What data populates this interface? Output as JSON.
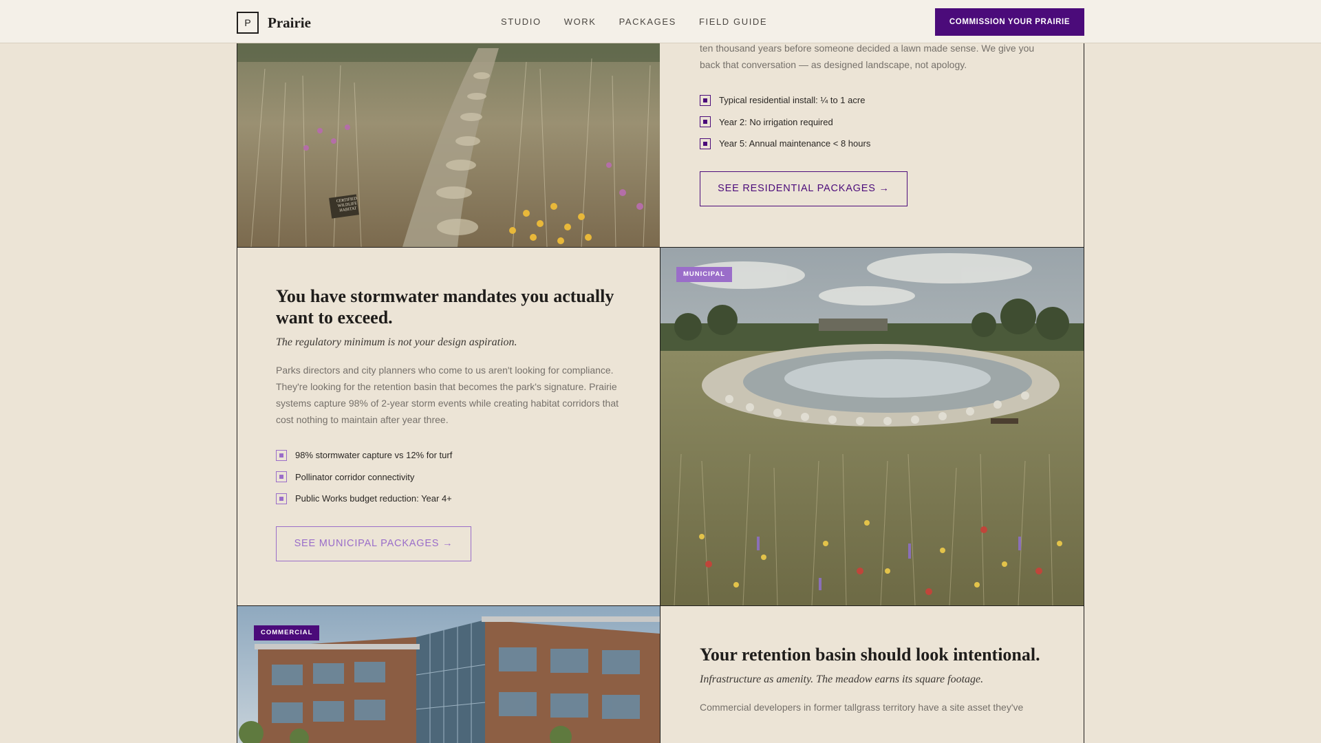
{
  "nav": {
    "logo_mark": "P",
    "brand": "Prairie",
    "links": [
      "STUDIO",
      "WORK",
      "PACKAGES",
      "FIELD GUIDE"
    ],
    "cta": "COMMISSION YOUR PRAIRIE"
  },
  "residential": {
    "body_tail": "ten thousand years before someone decided a lawn made sense. We give you back that conversation — as designed landscape, not apology.",
    "bullets": [
      "Typical residential install: ¼ to 1 acre",
      "Year 2: No irrigation required",
      "Year 5: Annual maintenance < 8 hours"
    ],
    "button": "SEE RESIDENTIAL PACKAGES →"
  },
  "municipal": {
    "tag": "MUNICIPAL",
    "heading": "You have stormwater mandates you actually want to exceed.",
    "subheading": "The regulatory minimum is not your design aspiration.",
    "body": "Parks directors and city planners who come to us aren't looking for compliance. They're looking for the retention basin that becomes the park's signature. Prairie systems capture 98% of 2-year storm events while creating habitat corridors that cost nothing to maintain after year three.",
    "bullets": [
      "98% stormwater capture vs 12% for turf",
      "Pollinator corridor connectivity",
      "Public Works budget reduction: Year 4+"
    ],
    "button": "SEE MUNICIPAL PACKAGES →"
  },
  "commercial": {
    "tag": "COMMERCIAL",
    "heading": "Your retention basin should look intentional.",
    "subheading": "Infrastructure as amenity. The meadow earns its square footage.",
    "body_start": "Commercial developers in former tallgrass territory have a site asset they've"
  },
  "colors": {
    "accent": "#4b0b7a",
    "accent_light": "#9a6dc9",
    "background": "#ece4d6"
  },
  "images": {
    "residential_photo": "Prairie garden with stone path and sign",
    "municipal_photo": "Retention pond surrounded by wildflower meadow",
    "commercial_photo": "Three-storey office building with glass atrium"
  },
  "photo_sign_text": [
    "CERTIFIED",
    "WILDLIFE",
    "HABITAT"
  ]
}
